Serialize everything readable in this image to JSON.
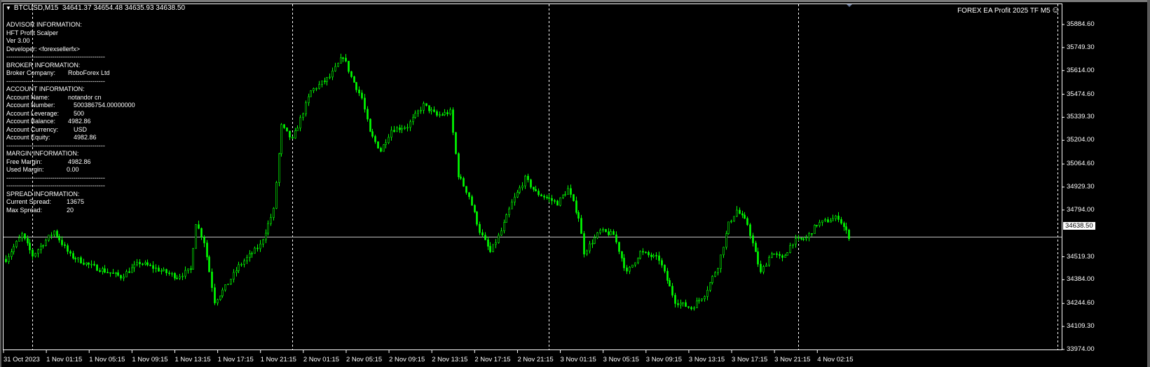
{
  "header": {
    "symbol": "BTCUSD,M15",
    "ohlc": "34641.37 34654.48 34635.93 34638.50",
    "ea_name": "FOREX EA Profit 2025 TF M5",
    "smiley": "☺"
  },
  "info_panel": [
    {
      "label": "ADVISOR INFORMATION:"
    },
    {
      "label": "HFT Profit Scalper"
    },
    {
      "label": "Ver 3.00"
    },
    {
      "label": "Developer: <forexsellerfx>"
    },
    {
      "label": "-----------------------------------------------"
    },
    {
      "label": "BROKER INFORMATION:"
    },
    {
      "label": "Broker Company:",
      "value": "RoboForex Ltd",
      "offset": "v1"
    },
    {
      "label": "-----------------------------------------------"
    },
    {
      "label": "ACCOUNT INFORMATION:"
    },
    {
      "label": "Account Name:",
      "value": "notandor cn",
      "offset": "v1"
    },
    {
      "label": "Account Number:",
      "value": "500386754.00000000",
      "offset": "v2"
    },
    {
      "label": "Account Leverage:",
      "value": "500",
      "offset": "v2"
    },
    {
      "label": "Account Balance:",
      "value": "4982.86",
      "offset": "v1"
    },
    {
      "label": "Account Currency:",
      "value": "USD",
      "offset": "v2"
    },
    {
      "label": "Account Equity:",
      "value": "4982.86",
      "offset": "v2"
    },
    {
      "label": "-----------------------------------------------"
    },
    {
      "label": "MARGIN INFORMATION:"
    },
    {
      "label": "Free Margin:",
      "value": "4982.86",
      "offset": "v3"
    },
    {
      "label": "Used Margin:",
      "value": "0.00",
      "offset": "v4"
    },
    {
      "label": "-----------------------------------------------"
    },
    {
      "label": "-----------------------------------------------"
    },
    {
      "label": "SPREAD INFORMATION:"
    },
    {
      "label": "Current Spread:",
      "value": "13675",
      "offset": "v4"
    },
    {
      "label": "Max Spread:",
      "value": "20",
      "offset": "v4"
    }
  ],
  "colors": {
    "candle": "#00ff00",
    "grid": "#ffffff",
    "bid_line": "#c0c0c0"
  },
  "chart_data": {
    "type": "candlestick",
    "symbol": "BTCUSD",
    "timeframe": "M15",
    "ylim": [
      33974.0,
      35884.6
    ],
    "current_price": "34638.50",
    "price_ticks": [
      "35884.60",
      "35749.30",
      "35614.00",
      "35474.60",
      "35339.30",
      "35204.00",
      "35064.60",
      "34929.30",
      "34794.00",
      "34519.30",
      "34384.00",
      "34244.60",
      "34109.30",
      "33974.00"
    ],
    "time_ticks": [
      "31 Oct 2023",
      "1 Nov 01:15",
      "1 Nov 05:15",
      "1 Nov 09:15",
      "1 Nov 13:15",
      "1 Nov 17:15",
      "1 Nov 21:15",
      "2 Nov 01:15",
      "2 Nov 05:15",
      "2 Nov 09:15",
      "2 Nov 13:15",
      "2 Nov 17:15",
      "2 Nov 21:15",
      "3 Nov 01:15",
      "3 Nov 05:15",
      "3 Nov 09:15",
      "3 Nov 13:15",
      "3 Nov 17:15",
      "3 Nov 21:15",
      "4 Nov 02:15"
    ],
    "bars_per_time_tick": 16,
    "bar_count": 316,
    "day_separators_bar_index": [
      10,
      107,
      203,
      296,
      393
    ],
    "close_path": [
      [
        0,
        34505
      ],
      [
        6,
        34649
      ],
      [
        10,
        34526
      ],
      [
        18,
        34670
      ],
      [
        24,
        34526
      ],
      [
        32,
        34464
      ],
      [
        43,
        34402
      ],
      [
        50,
        34485
      ],
      [
        64,
        34402
      ],
      [
        69,
        34443
      ],
      [
        71,
        34720
      ],
      [
        74,
        34608
      ],
      [
        78,
        34258
      ],
      [
        82,
        34340
      ],
      [
        87,
        34464
      ],
      [
        95,
        34587
      ],
      [
        100,
        34793
      ],
      [
        103,
        35287
      ],
      [
        107,
        35205
      ],
      [
        114,
        35493
      ],
      [
        121,
        35576
      ],
      [
        126,
        35700
      ],
      [
        129,
        35576
      ],
      [
        133,
        35452
      ],
      [
        136,
        35246
      ],
      [
        140,
        35143
      ],
      [
        144,
        35266
      ],
      [
        150,
        35287
      ],
      [
        156,
        35411
      ],
      [
        161,
        35349
      ],
      [
        166,
        35370
      ],
      [
        169,
        35000
      ],
      [
        173,
        34876
      ],
      [
        177,
        34670
      ],
      [
        181,
        34546
      ],
      [
        185,
        34670
      ],
      [
        189,
        34835
      ],
      [
        194,
        34979
      ],
      [
        198,
        34897
      ],
      [
        206,
        34835
      ],
      [
        210,
        34917
      ],
      [
        214,
        34752
      ],
      [
        216,
        34546
      ],
      [
        222,
        34670
      ],
      [
        227,
        34649
      ],
      [
        232,
        34423
      ],
      [
        237,
        34546
      ],
      [
        244,
        34505
      ],
      [
        250,
        34258
      ],
      [
        256,
        34217
      ],
      [
        261,
        34299
      ],
      [
        266,
        34464
      ],
      [
        270,
        34711
      ],
      [
        273,
        34793
      ],
      [
        277,
        34711
      ],
      [
        282,
        34423
      ],
      [
        286,
        34546
      ],
      [
        290,
        34505
      ],
      [
        294,
        34608
      ],
      [
        299,
        34629
      ],
      [
        303,
        34711
      ],
      [
        311,
        34752
      ],
      [
        315,
        34638.5
      ]
    ]
  }
}
